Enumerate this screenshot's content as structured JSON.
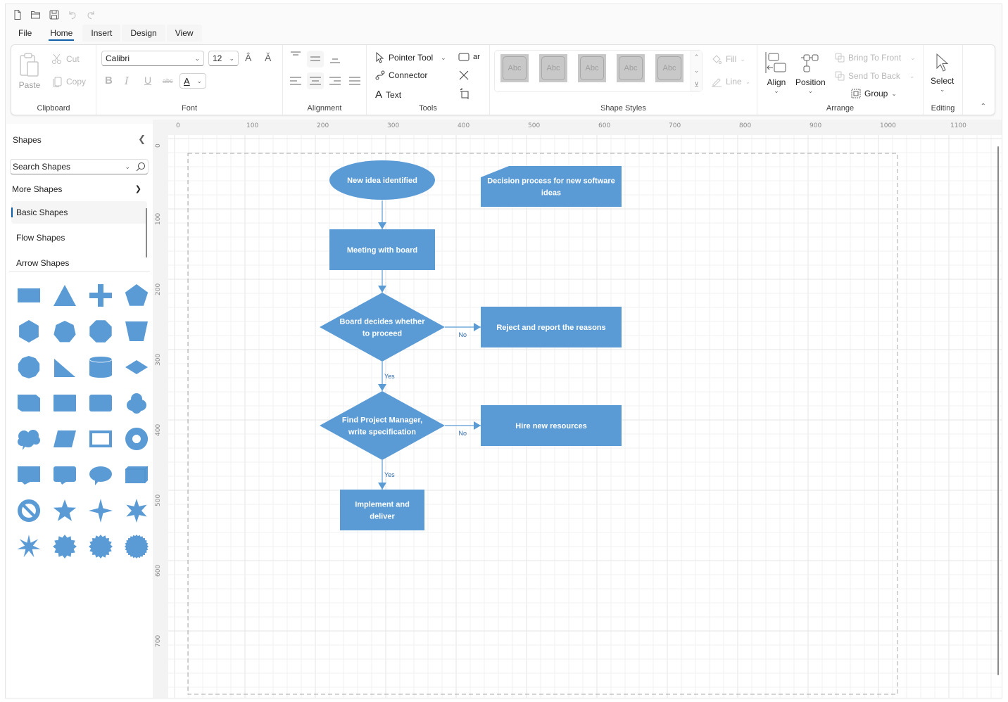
{
  "quick_access": {
    "icons": [
      "new-file-icon",
      "open-folder-icon",
      "save-icon",
      "undo-icon",
      "redo-icon"
    ]
  },
  "tabs": [
    {
      "label": "File",
      "active": false
    },
    {
      "label": "Home",
      "active": true
    },
    {
      "label": "Insert",
      "active": false
    },
    {
      "label": "Design",
      "active": false
    },
    {
      "label": "View",
      "active": false
    }
  ],
  "ribbon": {
    "clipboard": {
      "label": "Clipboard",
      "paste": "Paste",
      "cut": "Cut",
      "copy": "Copy"
    },
    "font": {
      "label": "Font",
      "family": "Calibri",
      "size": "12",
      "bold": "B",
      "italic": "I",
      "underline": "U",
      "strike": "abc",
      "color": "A"
    },
    "alignment": {
      "label": "Alignment"
    },
    "tools": {
      "label": "Tools",
      "pointer": "Pointer Tool",
      "connector": "Connector",
      "text": "Text",
      "rect_label": "ar"
    },
    "shape_styles": {
      "label": "Shape Styles",
      "swatches": [
        "Abc",
        "Abc",
        "Abc",
        "Abc",
        "Abc"
      ],
      "fill": "Fill",
      "line": "Line"
    },
    "arrange": {
      "label": "Arrange",
      "align": "Align",
      "position": "Position",
      "bring_to_front": "Bring To Front",
      "send_to_back": "Send To Back",
      "group": "Group"
    },
    "editing": {
      "label": "Editing",
      "select": "Select"
    }
  },
  "palette": {
    "title": "Shapes",
    "search_placeholder": "Search Shapes",
    "more_shapes": "More Shapes",
    "categories": [
      {
        "label": "Basic Shapes",
        "active": true
      },
      {
        "label": "Flow Shapes",
        "active": false
      },
      {
        "label": "Arrow Shapes",
        "active": false
      }
    ],
    "shapes": [
      "rectangle",
      "triangle",
      "plus",
      "pentagon",
      "hexagon",
      "heptagon",
      "octagon",
      "trapezoid",
      "decagon",
      "right-triangle",
      "cylinder",
      "diamond",
      "snip-rectangle",
      "rectangle-2",
      "rounded-rectangle",
      "cloud",
      "thought-cloud",
      "parallelogram",
      "frame",
      "donut",
      "rectangle-callout",
      "rounded-callout",
      "oval-callout",
      "cube",
      "no-symbol",
      "star-5",
      "star-4",
      "star-6",
      "star-7",
      "star-12",
      "star-16",
      "star-24"
    ]
  },
  "ruler": {
    "horizontal": [
      "0",
      "100",
      "200",
      "300",
      "400",
      "500",
      "600",
      "700",
      "800",
      "900",
      "1000",
      "1100"
    ],
    "vertical": [
      "0",
      "100",
      "200",
      "300",
      "400",
      "500",
      "600",
      "700"
    ]
  },
  "diagram": {
    "color": "#5b9bd5",
    "nodes": [
      {
        "id": "start",
        "shape": "ellipse",
        "text": [
          "New idea identified"
        ]
      },
      {
        "id": "meeting",
        "shape": "rect",
        "text": [
          "Meeting with board"
        ]
      },
      {
        "id": "decide",
        "shape": "diamond",
        "text": [
          "Board decides whether",
          "to proceed"
        ]
      },
      {
        "id": "reject",
        "shape": "rect",
        "text": [
          "Reject and report the reasons"
        ]
      },
      {
        "id": "findpm",
        "shape": "diamond",
        "text": [
          "Find Project Manager,",
          "write specification"
        ]
      },
      {
        "id": "hire",
        "shape": "rect",
        "text": [
          "Hire new resources"
        ]
      },
      {
        "id": "implement",
        "shape": "rect",
        "text": [
          "Implement and",
          "deliver"
        ]
      },
      {
        "id": "title",
        "shape": "card",
        "text": [
          "Decision process for new software",
          "ideas"
        ]
      }
    ],
    "connectors": [
      {
        "from": "start",
        "to": "meeting",
        "label": ""
      },
      {
        "from": "meeting",
        "to": "decide",
        "label": ""
      },
      {
        "from": "decide",
        "to": "reject",
        "label": "No"
      },
      {
        "from": "decide",
        "to": "findpm",
        "label": "Yes"
      },
      {
        "from": "findpm",
        "to": "hire",
        "label": "No"
      },
      {
        "from": "findpm",
        "to": "implement",
        "label": "Yes"
      }
    ]
  }
}
